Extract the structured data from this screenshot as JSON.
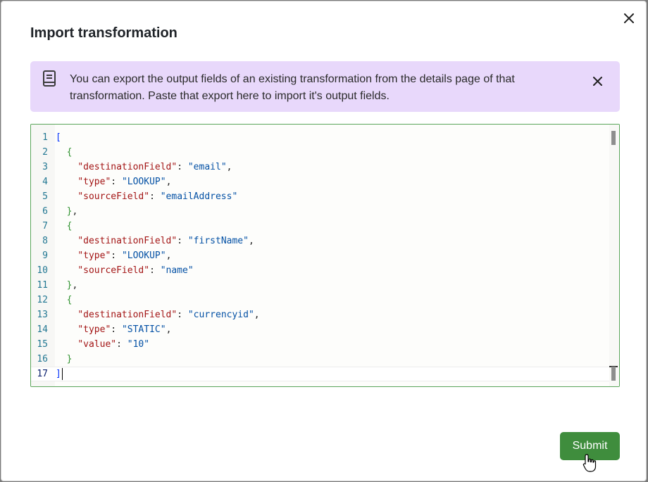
{
  "dialog": {
    "title": "Import transformation",
    "close_icon": "close-icon"
  },
  "banner": {
    "icon": "document-icon",
    "text": "You can export the output fields of an existing transformation from the details page of that transformation. Paste that export here to import it's output fields.",
    "close_icon": "close-icon",
    "background": "#e8d8fb"
  },
  "editor": {
    "active_line": 17,
    "lines": [
      {
        "n": "1",
        "text": "["
      },
      {
        "n": "2",
        "text": "  {"
      },
      {
        "n": "3",
        "text": "    \"destinationField\": \"email\","
      },
      {
        "n": "4",
        "text": "    \"type\": \"LOOKUP\","
      },
      {
        "n": "5",
        "text": "    \"sourceField\": \"emailAddress\""
      },
      {
        "n": "6",
        "text": "  },"
      },
      {
        "n": "7",
        "text": "  {"
      },
      {
        "n": "8",
        "text": "    \"destinationField\": \"firstName\","
      },
      {
        "n": "9",
        "text": "    \"type\": \"LOOKUP\","
      },
      {
        "n": "10",
        "text": "    \"sourceField\": \"name\""
      },
      {
        "n": "11",
        "text": "  },"
      },
      {
        "n": "12",
        "text": "  {"
      },
      {
        "n": "13",
        "text": "    \"destinationField\": \"currencyid\","
      },
      {
        "n": "14",
        "text": "    \"type\": \"STATIC\","
      },
      {
        "n": "15",
        "text": "    \"value\": \"10\""
      },
      {
        "n": "16",
        "text": "  }"
      },
      {
        "n": "17",
        "text": "]"
      }
    ]
  },
  "actions": {
    "submit_label": "Submit",
    "submit_color": "#3f8d3d"
  }
}
